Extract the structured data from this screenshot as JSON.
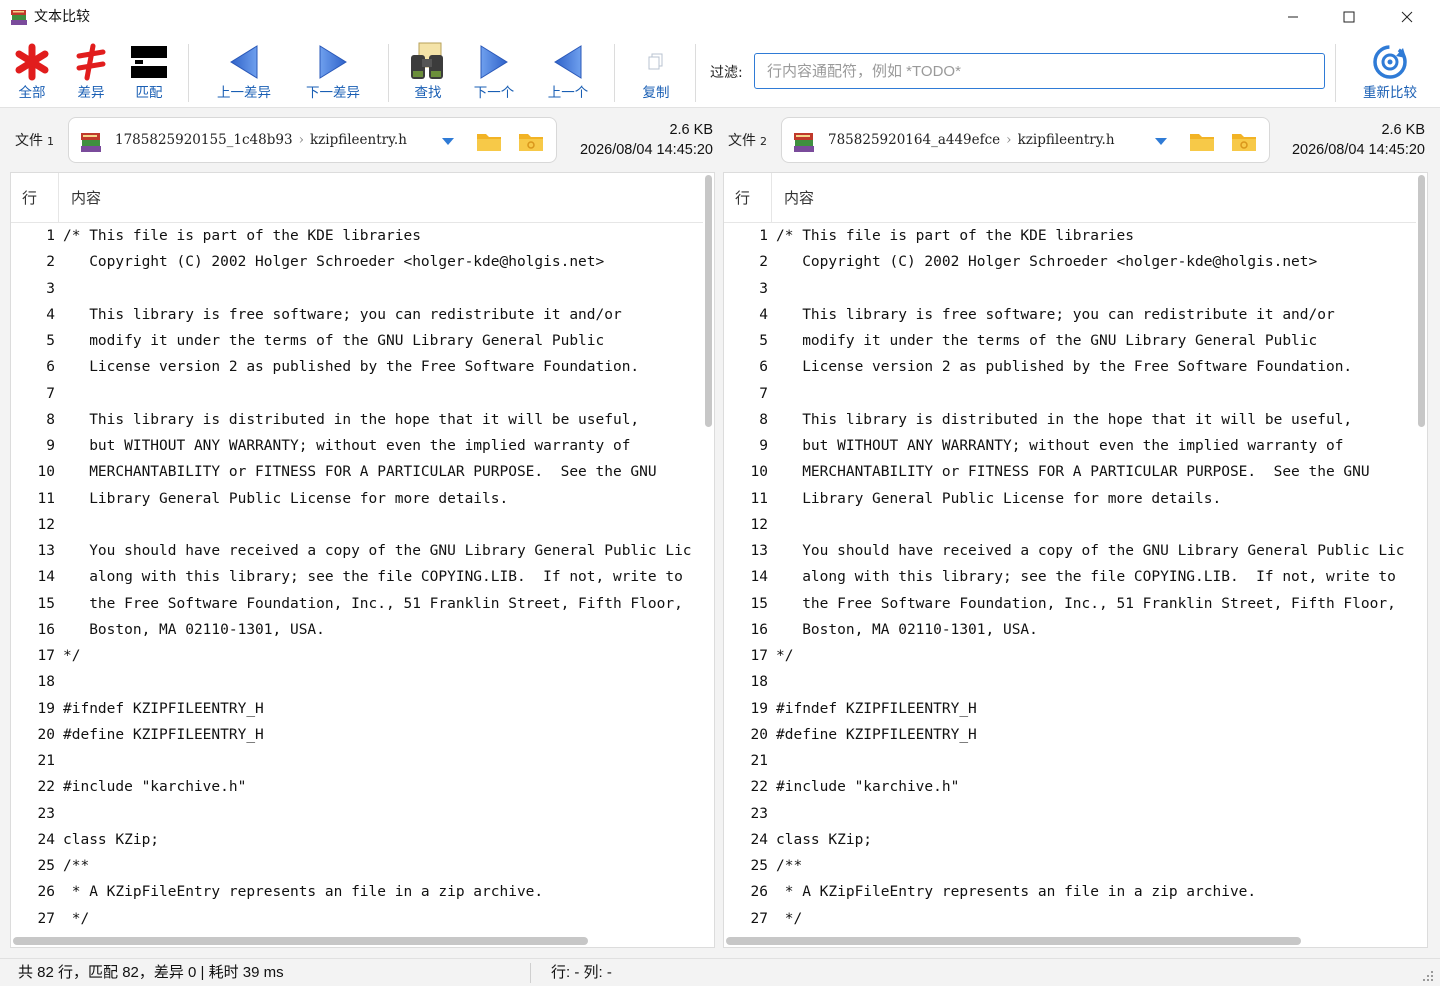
{
  "window": {
    "title": "文本比较",
    "controls": {
      "minimize": "minimize",
      "maximize": "maximize",
      "close": "close"
    }
  },
  "toolbar": {
    "buttons": [
      {
        "label": "全部",
        "icon": "asterisk-icon"
      },
      {
        "label": "差异",
        "icon": "diff-icon"
      },
      {
        "label": "匹配",
        "icon": "match-icon"
      },
      {
        "label": "上一差异",
        "icon": "arrow-left-icon"
      },
      {
        "label": "下一差异",
        "icon": "arrow-right-icon"
      },
      {
        "label": "查找",
        "icon": "binoculars-icon"
      },
      {
        "label": "下一个",
        "icon": "arrow-right-icon"
      },
      {
        "label": "上一个",
        "icon": "arrow-left-icon"
      },
      {
        "label": "复制",
        "icon": "copy-icon"
      }
    ],
    "filter_label": "过滤:",
    "filter_placeholder": "行内容通配符，例如 *TODO*",
    "filter_value": "",
    "recompare_label": "重新比较"
  },
  "files": [
    {
      "label": "文件",
      "index": "1",
      "archive": "1785825920155_1c48b93",
      "name": "kzipfileentry.h",
      "size": "2.6 KB",
      "modified": "2026/08/04 14:45:20"
    },
    {
      "label": "文件",
      "index": "2",
      "archive": "785825920164_a449efce",
      "name": "kzipfileentry.h",
      "size": "2.6 KB",
      "modified": "2026/08/04 14:45:20"
    }
  ],
  "columns": {
    "line": "行",
    "content": "内容"
  },
  "lines": [
    "/* This file is part of the KDE libraries",
    "   Copyright (C) 2002 Holger Schroeder <holger-kde@holgis.net>",
    "",
    "   This library is free software; you can redistribute it and/or",
    "   modify it under the terms of the GNU Library General Public",
    "   License version 2 as published by the Free Software Foundation.",
    "",
    "   This library is distributed in the hope that it will be useful,",
    "   but WITHOUT ANY WARRANTY; without even the implied warranty of",
    "   MERCHANTABILITY or FITNESS FOR A PARTICULAR PURPOSE.  See the GNU",
    "   Library General Public License for more details.",
    "",
    "   You should have received a copy of the GNU Library General Public Lic",
    "   along with this library; see the file COPYING.LIB.  If not, write to",
    "   the Free Software Foundation, Inc., 51 Franklin Street, Fifth Floor,",
    "   Boston, MA 02110-1301, USA.",
    "*/",
    "",
    "#ifndef KZIPFILEENTRY_H",
    "#define KZIPFILEENTRY_H",
    "",
    "#include \"karchive.h\"",
    "",
    "class KZip;",
    "/**",
    " * A KZipFileEntry represents an file in a zip archive.",
    " */"
  ],
  "status": {
    "summary": "共 82 行，匹配 82，差异 0 | 耗时 39 ms",
    "cursor": "行: -  列: -"
  },
  "colors": {
    "accent": "#1a5fb4",
    "filter_border": "#2f7bd6",
    "folder": "#f2b325"
  }
}
